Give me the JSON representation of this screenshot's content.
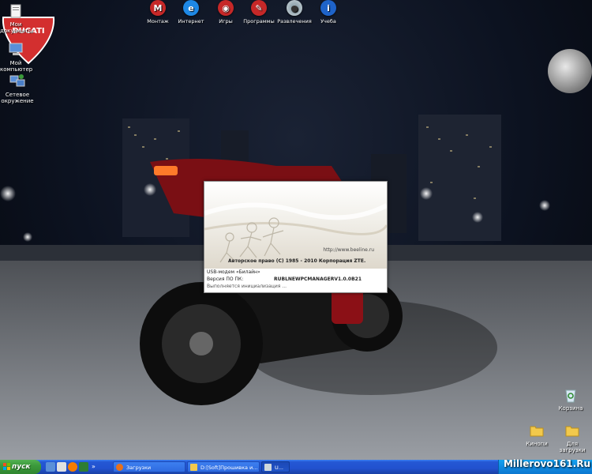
{
  "desktop_icons": [
    {
      "name": "desktop-icon-documents",
      "label": "Мои документы",
      "icon": "folder-documents-icon"
    },
    {
      "name": "desktop-icon-computer",
      "label": "Мой компьютер",
      "icon": "computer-icon"
    },
    {
      "name": "desktop-icon-network",
      "label": "Сетевое окружение",
      "icon": "network-icon"
    },
    {
      "name": "desktop-icon-recycle",
      "label": "Корзина",
      "icon": "recycle-bin-icon"
    },
    {
      "name": "desktop-icon-kino",
      "label": "Кинопи",
      "icon": "folder-icon"
    },
    {
      "name": "desktop-icon-downloads",
      "label": "Для загрузки",
      "icon": "folder-icon"
    }
  ],
  "top_bar": [
    {
      "label": "Монтаж",
      "icon": "monitor-icon",
      "color": "#c62828"
    },
    {
      "label": "Интернет",
      "icon": "internet-icon",
      "color": "#1e88e5"
    },
    {
      "label": "Игры",
      "icon": "eye-icon",
      "color": "#c62828"
    },
    {
      "label": "Программы",
      "icon": "pencil-icon",
      "color": "#c62828"
    },
    {
      "label": "Развлечения",
      "icon": "disc-icon",
      "color": "#90a4ae"
    },
    {
      "label": "Учеба",
      "icon": "info-icon",
      "color": "#1e63c9"
    }
  ],
  "brand_logo": {
    "text": "DUCATI",
    "color": "#d32f2f"
  },
  "splash": {
    "url": "http://www.beeline.ru",
    "copyright": "Авторское право (C) 1985 - 2010 Корпорация ZTE.",
    "modem_line": "USB-модем «Билайн»",
    "version_label": "Версия ПО ПК:",
    "version_value": "RUBLNEWPCMANAGERV1.0.0B21",
    "status": "Выполняется инициализация ..."
  },
  "taskbar": {
    "start_label": "пуск",
    "tasks": [
      {
        "label": "Загрузки",
        "active": false
      },
      {
        "label": "D:[Soft]Прошивка и...",
        "active": false
      },
      {
        "label": "U...",
        "active": true
      }
    ]
  },
  "watermark": "Millerovo161.Ru",
  "colors": {
    "taskbar_blue": "#2458d4",
    "start_green": "#3c9a3c",
    "tray_blue": "#0f8be2"
  }
}
